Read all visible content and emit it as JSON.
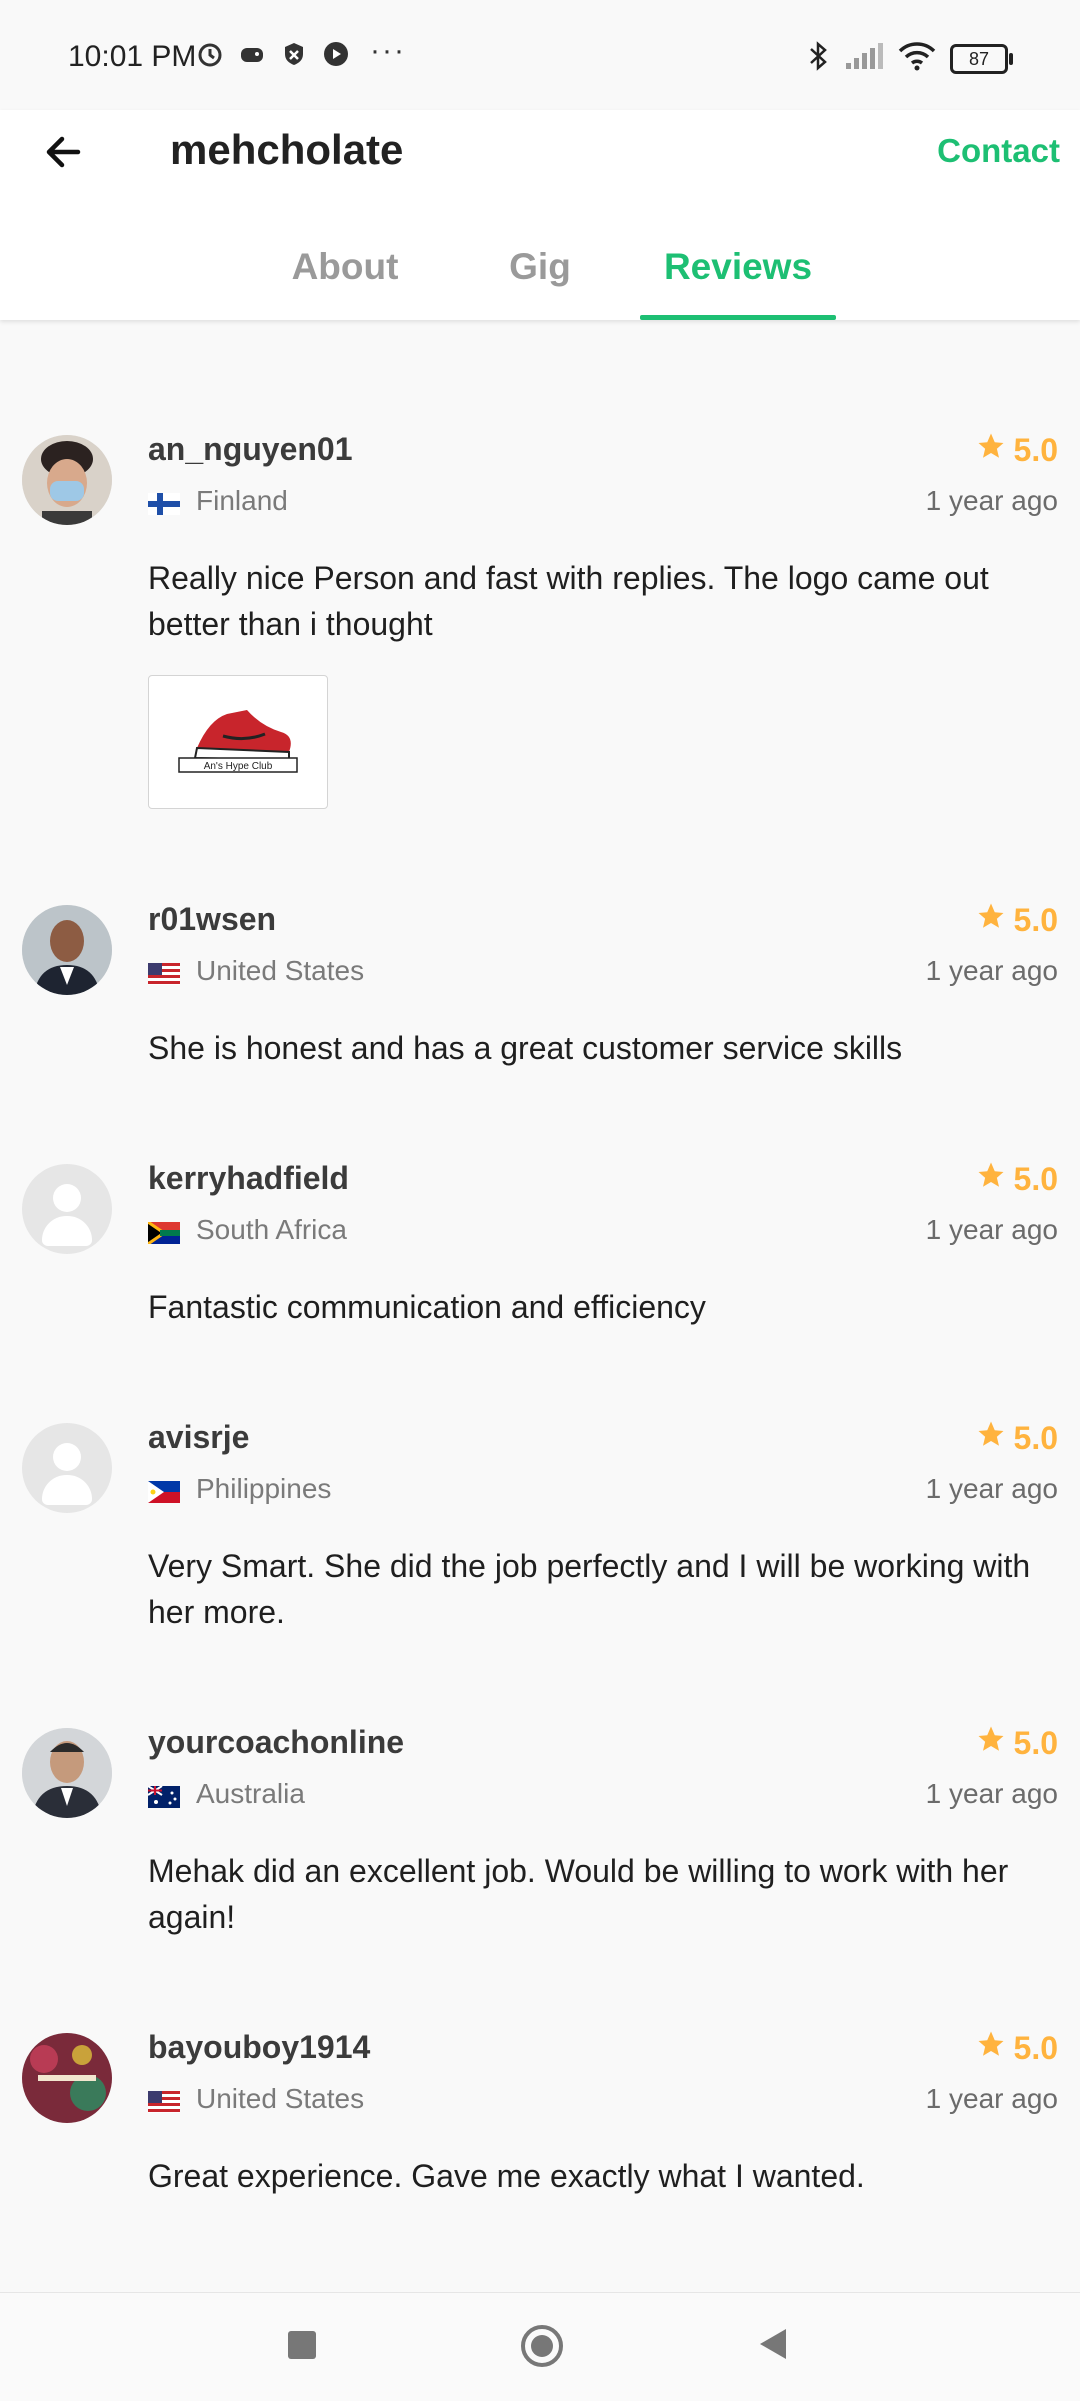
{
  "status_bar": {
    "time": "10:01 PM",
    "more": "···",
    "battery": "87"
  },
  "header": {
    "title": "mehcholate",
    "contact_label": "Contact",
    "tabs": [
      {
        "label": "About",
        "active": false
      },
      {
        "label": "Gig",
        "active": false
      },
      {
        "label": "Reviews",
        "active": true
      }
    ]
  },
  "colors": {
    "accent_green": "#1dbf73",
    "rating_orange": "#ffb33e"
  },
  "reviews": [
    {
      "username": "an_nguyen01",
      "country": "Finland",
      "flag": "finland-flag",
      "rating": "5.0",
      "time": "1 year ago",
      "comment": "Really nice Person and fast with replies. The logo came out better than i thought",
      "has_attachment": true,
      "attachment_caption": "An's Hype Club"
    },
    {
      "username": "r01wsen",
      "country": "United States",
      "flag": "us-flag",
      "rating": "5.0",
      "time": "1 year ago",
      "comment": "She is honest and has a great customer service skills"
    },
    {
      "username": "kerryhadfield",
      "country": "South Africa",
      "flag": "south-africa-flag",
      "rating": "5.0",
      "time": "1 year ago",
      "comment": "Fantastic communication and efficiency"
    },
    {
      "username": "avisrje",
      "country": "Philippines",
      "flag": "philippines-flag",
      "rating": "5.0",
      "time": "1 year ago",
      "comment": "Very Smart. She did the job perfectly and I will be working with her more."
    },
    {
      "username": "yourcoachonline",
      "country": "Australia",
      "flag": "australia-flag",
      "rating": "5.0",
      "time": "1 year ago",
      "comment": "Mehak did an excellent job. Would be willing to work with her again!"
    },
    {
      "username": "bayouboy1914",
      "country": "United States",
      "flag": "us-flag",
      "rating": "5.0",
      "time": "1 year ago",
      "comment": "Great experience. Gave me exactly what I wanted."
    }
  ]
}
